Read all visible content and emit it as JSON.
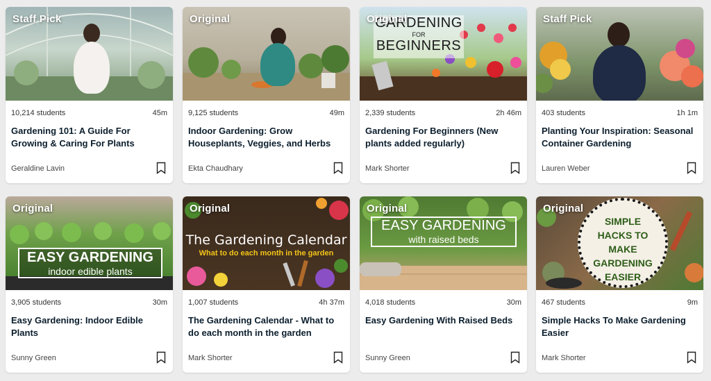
{
  "courses": [
    {
      "tag": "Staff Pick",
      "students": "10,214 students",
      "duration": "45m",
      "title": "Gardening 101: A Guide For Growing & Caring For Plants",
      "author": "Geraldine Lavin"
    },
    {
      "tag": "Original",
      "students": "9,125 students",
      "duration": "49m",
      "title": "Indoor Gardening: Grow Houseplants, Veggies, and Herbs",
      "author": "Ekta Chaudhary"
    },
    {
      "tag": "Original",
      "students": "2,339 students",
      "duration": "2h 46m",
      "title": "Gardening For Beginners (New plants added regularly)",
      "author": "Mark Shorter",
      "thumb_line1": "GARDENING",
      "thumb_line2": "FOR",
      "thumb_line3": "BEGINNERS"
    },
    {
      "tag": "Staff Pick",
      "students": "403 students",
      "duration": "1h 1m",
      "title": "Planting Your Inspiration: Seasonal Container Gardening",
      "author": "Lauren Weber"
    },
    {
      "tag": "Original",
      "students": "3,905 students",
      "duration": "30m",
      "title": "Easy Gardening: Indoor Edible Plants",
      "author": "Sunny Green",
      "thumb_line1": "EASY GARDENING",
      "thumb_line2": "indoor edible plants"
    },
    {
      "tag": "Original",
      "students": "1,007 students",
      "duration": "4h 37m",
      "title": "The Gardening Calendar - What to do each month in the garden",
      "author": "Mark Shorter",
      "thumb_line1": "The Gardening Calendar",
      "thumb_line2": "What to do each month in the garden"
    },
    {
      "tag": "Original",
      "students": "4,018 students",
      "duration": "30m",
      "title": "Easy Gardening With Raised Beds",
      "author": "Sunny Green",
      "thumb_line1": "EASY GARDENING",
      "thumb_line2": "with raised beds"
    },
    {
      "tag": "Original",
      "students": "467 students",
      "duration": "9m",
      "title": "Simple Hacks To Make Gardening Easier",
      "author": "Mark Shorter",
      "thumb_line1": "SIMPLE",
      "thumb_line2": "HACKS TO",
      "thumb_line3": "MAKE",
      "thumb_line4": "GARDENING",
      "thumb_line5": "EASIER"
    }
  ],
  "colors": {
    "tag_text": "#ffffff",
    "title_text": "#0b1e2d",
    "calendar_yellow": "#f5c518",
    "hacks_green": "#2e5d18"
  },
  "icons": {
    "bookmark": "bookmark-icon"
  }
}
